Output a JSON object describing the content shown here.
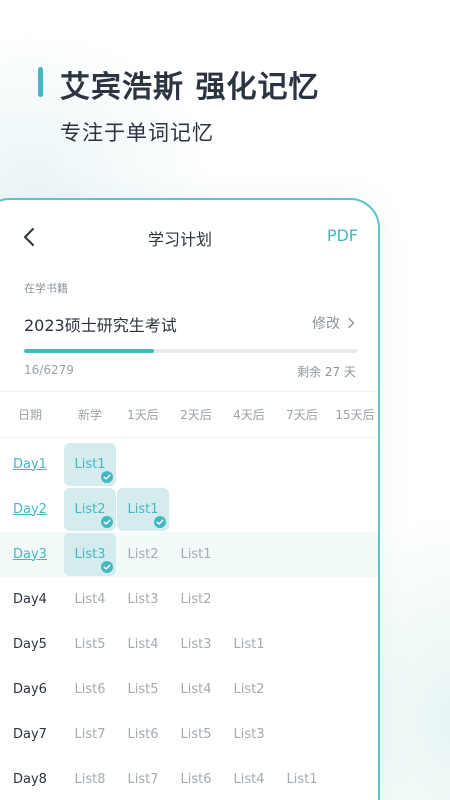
{
  "hero": {
    "title": "艾宾浩斯 强化记忆",
    "subtitle": "专注于单词记忆"
  },
  "nav": {
    "title": "学习计划",
    "pdf_label": "PDF"
  },
  "book": {
    "label": "在学书籍",
    "name": "2023硕士研究生考试",
    "edit_label": "修改"
  },
  "progress": {
    "count": "16/6279",
    "remaining": "剩余 27 天",
    "fraction": 0.39
  },
  "table": {
    "headers": [
      "日期",
      "新学",
      "1天后",
      "2天后",
      "4天后",
      "7天后",
      "15天后"
    ],
    "rows": [
      {
        "day": "Day1",
        "link": true,
        "current": false,
        "cells": [
          "List1",
          "",
          "",
          "",
          "",
          ""
        ],
        "done": [
          true,
          false,
          false,
          false,
          false,
          false
        ]
      },
      {
        "day": "Day2",
        "link": true,
        "current": false,
        "cells": [
          "List2",
          "List1",
          "",
          "",
          "",
          ""
        ],
        "done": [
          true,
          true,
          false,
          false,
          false,
          false
        ]
      },
      {
        "day": "Day3",
        "link": true,
        "current": true,
        "cells": [
          "List3",
          "List2",
          "List1",
          "",
          "",
          ""
        ],
        "done": [
          true,
          false,
          false,
          false,
          false,
          false
        ]
      },
      {
        "day": "Day4",
        "link": false,
        "current": false,
        "cells": [
          "List4",
          "List3",
          "List2",
          "",
          "",
          ""
        ],
        "done": [
          false,
          false,
          false,
          false,
          false,
          false
        ]
      },
      {
        "day": "Day5",
        "link": false,
        "current": false,
        "cells": [
          "List5",
          "List4",
          "List3",
          "List1",
          "",
          ""
        ],
        "done": [
          false,
          false,
          false,
          false,
          false,
          false
        ]
      },
      {
        "day": "Day6",
        "link": false,
        "current": false,
        "cells": [
          "List6",
          "List5",
          "List4",
          "List2",
          "",
          ""
        ],
        "done": [
          false,
          false,
          false,
          false,
          false,
          false
        ]
      },
      {
        "day": "Day7",
        "link": false,
        "current": false,
        "cells": [
          "List7",
          "List6",
          "List5",
          "List3",
          "",
          ""
        ],
        "done": [
          false,
          false,
          false,
          false,
          false,
          false
        ]
      },
      {
        "day": "Day8",
        "link": false,
        "current": false,
        "cells": [
          "List8",
          "List7",
          "List6",
          "List4",
          "List1",
          ""
        ],
        "done": [
          false,
          false,
          false,
          false,
          false,
          false
        ]
      }
    ]
  },
  "colors": {
    "accent": "#43b8c3",
    "chip": "#d4ecee",
    "text": "#2b3440",
    "muted": "#a4abb1"
  },
  "icons": {
    "back": "chevron-left-icon",
    "edit": "chevron-right-icon",
    "done": "check-circle-icon"
  }
}
